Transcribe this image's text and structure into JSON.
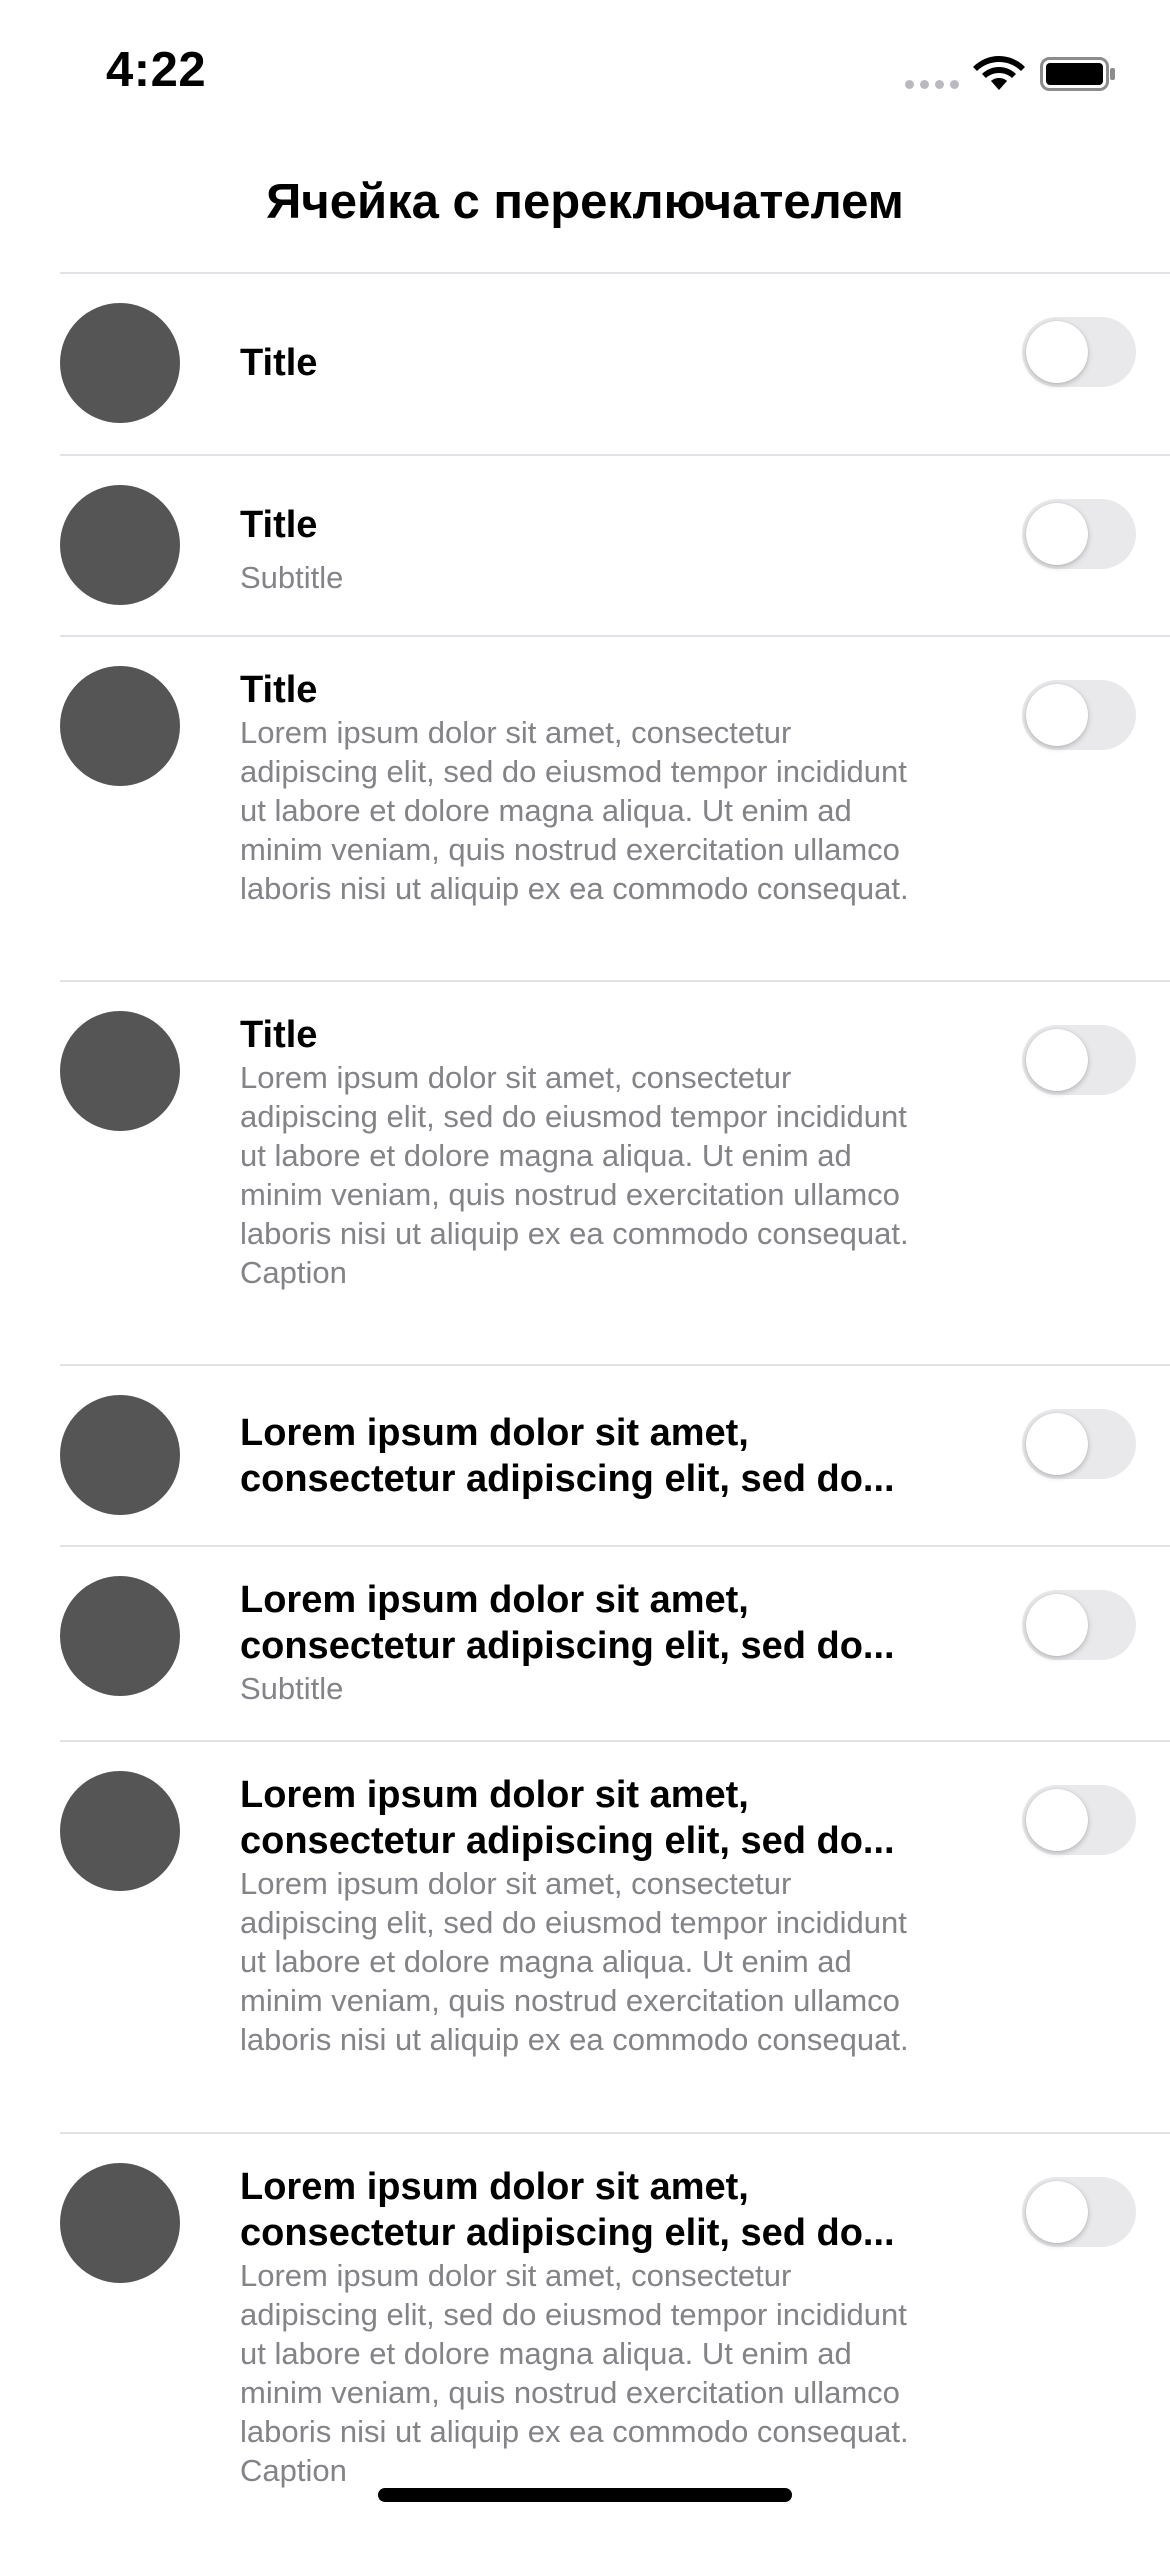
{
  "status_bar": {
    "time": "4:22",
    "icons": [
      "cellular-signal-icon",
      "wifi-icon",
      "battery-icon"
    ]
  },
  "nav": {
    "title": "Ячейка с переключателем"
  },
  "colors": {
    "avatar": "#555555",
    "toggle_off_track": "#e9e9eb",
    "secondary_text": "#838388",
    "divider": "#e2e2e6"
  },
  "cells": [
    {
      "title": "Title",
      "subtitle": "",
      "caption": "",
      "toggle_on": false
    },
    {
      "title": "Title",
      "subtitle": "Subtitle",
      "caption": "",
      "toggle_on": false
    },
    {
      "title": "Title",
      "subtitle": "Lorem ipsum dolor sit amet, consectetur adipiscing elit, sed do eiusmod tempor incididunt ut labore et dolore magna aliqua. Ut enim ad minim veniam, quis nostrud exercitation ullamco laboris nisi ut aliquip ex ea commodo consequat.",
      "caption": "",
      "toggle_on": false
    },
    {
      "title": "Title",
      "subtitle": "Lorem ipsum dolor sit amet, consectetur adipiscing elit, sed do eiusmod tempor incididunt ut labore et dolore magna aliqua. Ut enim ad minim veniam, quis nostrud exercitation ullamco laboris nisi ut aliquip ex ea commodo consequat.",
      "caption": "Caption",
      "toggle_on": false
    },
    {
      "title": "Lorem ipsum dolor sit amet, consectetur adipiscing elit, sed do...",
      "subtitle": "",
      "caption": "",
      "toggle_on": false
    },
    {
      "title": "Lorem ipsum dolor sit amet, consectetur adipiscing elit, sed do...",
      "subtitle": "Subtitle",
      "caption": "",
      "toggle_on": false
    },
    {
      "title": "Lorem ipsum dolor sit amet, consectetur adipiscing elit, sed do...",
      "subtitle": "Lorem ipsum dolor sit amet, consectetur adipiscing elit, sed do eiusmod tempor incididunt ut labore et dolore magna aliqua. Ut enim ad minim veniam, quis nostrud exercitation ullamco laboris nisi ut aliquip ex ea commodo consequat.",
      "caption": "",
      "toggle_on": false
    },
    {
      "title": "Lorem ipsum dolor sit amet, consectetur adipiscing elit, sed do...",
      "subtitle": "Lorem ipsum dolor sit amet, consectetur adipiscing elit, sed do eiusmod tempor incididunt ut labore et dolore magna aliqua. Ut enim ad minim veniam, quis nostrud exercitation ullamco laboris nisi ut aliquip ex ea commodo consequat.",
      "caption": "Caption",
      "toggle_on": false
    }
  ]
}
